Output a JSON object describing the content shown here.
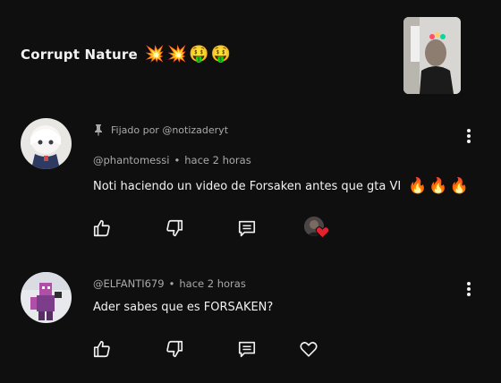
{
  "video": {
    "title": "Corrupt Nature",
    "title_emojis": [
      "💥",
      "💥",
      "🤑",
      "🤑"
    ]
  },
  "comments": [
    {
      "pinned_label": "Fijado por @notizaderyt",
      "author": "@phantomessi",
      "separator": "•",
      "time": "hace 2 horas",
      "text": "Noti haciendo un video de Forsaken antes que gta VI",
      "emojis": [
        "🔥",
        "🔥",
        "🔥"
      ],
      "actions": [
        "like-icon",
        "dislike-icon",
        "reply-icon",
        "creator-heart-icon"
      ]
    },
    {
      "author": "@ELFANTI679",
      "separator": "•",
      "time": "hace 2 horas",
      "text": "Ader sabes que es FORSAKEN?",
      "actions": [
        "like-icon",
        "dislike-icon",
        "reply-icon",
        "heart-icon"
      ]
    }
  ],
  "colors": {
    "background": "#0f0f0f",
    "text": "#f1f1f1",
    "meta": "#aaaaaa",
    "heart_red": "#e3212f"
  }
}
